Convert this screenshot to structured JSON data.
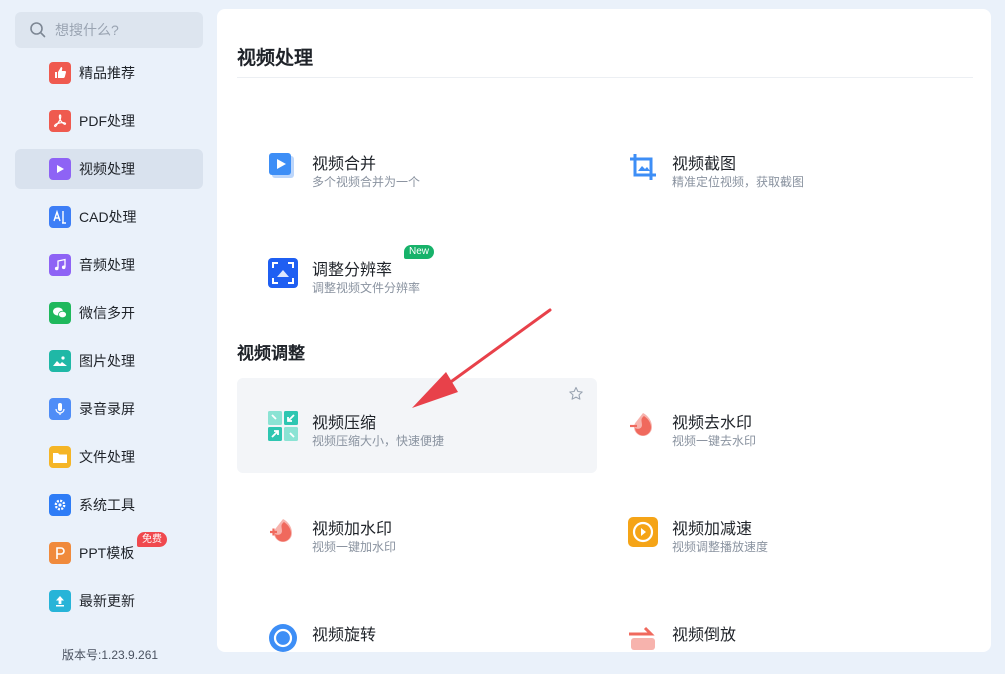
{
  "search": {
    "placeholder": "想搜什么?"
  },
  "sidebar": {
    "items": [
      {
        "label": "精品推荐",
        "icon": "thumbs-up-icon",
        "color": "#ef5a4f"
      },
      {
        "label": "PDF处理",
        "icon": "pdf-icon",
        "color": "#ef5a4f"
      },
      {
        "label": "视频处理",
        "icon": "video-play-icon",
        "color": "#8e63f5",
        "active": true
      },
      {
        "label": "CAD处理",
        "icon": "cad-icon",
        "color": "#3d7ef6"
      },
      {
        "label": "音频处理",
        "icon": "music-note-icon",
        "color": "#8e63f5"
      },
      {
        "label": "微信多开",
        "icon": "wechat-icon",
        "color": "#1fb85c"
      },
      {
        "label": "图片处理",
        "icon": "image-icon",
        "color": "#1fb8a6"
      },
      {
        "label": "录音录屏",
        "icon": "microphone-icon",
        "color": "#4f8df7"
      },
      {
        "label": "文件处理",
        "icon": "folder-icon",
        "color": "#f5b526"
      },
      {
        "label": "系统工具",
        "icon": "gear-icon",
        "color": "#2e7cf6"
      },
      {
        "label": "PPT模板",
        "icon": "ppt-icon",
        "color": "#f08a3c",
        "badge": "免费"
      },
      {
        "label": "最新更新",
        "icon": "upload-icon",
        "color": "#27b4d8"
      }
    ]
  },
  "version": "版本号:1.23.9.261",
  "main": {
    "section1_title": "视频处理",
    "section2_title": "视频调整",
    "section1_cards": [
      {
        "title": "视频合并",
        "desc": "多个视频合并为一个",
        "icon": "video-merge-icon",
        "color": "#3d8ef6"
      },
      {
        "title": "视频截图",
        "desc": "精准定位视频，获取截图",
        "icon": "crop-icon",
        "color": "#3d8ef6"
      },
      {
        "title": "调整分辨率",
        "desc": "调整视频文件分辨率",
        "icon": "resolution-icon",
        "color": "#1f5ff2",
        "badge": "New"
      }
    ],
    "section2_cards": [
      {
        "title": "视频压缩",
        "desc": "视频压缩大小，快速便捷",
        "icon": "compress-icon",
        "color": "#2ec6b1"
      },
      {
        "title": "视频去水印",
        "desc": "视频一键去水印",
        "icon": "remove-watermark-icon",
        "color": "#f0695d"
      },
      {
        "title": "视频加水印",
        "desc": "视频一键加水印",
        "icon": "add-watermark-icon",
        "color": "#f0695d"
      },
      {
        "title": "视频加减速",
        "desc": "视频调整播放速度",
        "icon": "speed-icon",
        "color": "#f5a417"
      },
      {
        "title": "视频旋转",
        "desc": "",
        "icon": "rotate-icon",
        "color": "#3d8ef6"
      },
      {
        "title": "视频倒放",
        "desc": "",
        "icon": "reverse-icon",
        "color": "#f0695d"
      }
    ]
  },
  "colors": {
    "accent_arrow": "#e8414a",
    "sidebar_bg": "#eaf1fa",
    "active_bg": "#d9e2ee"
  }
}
